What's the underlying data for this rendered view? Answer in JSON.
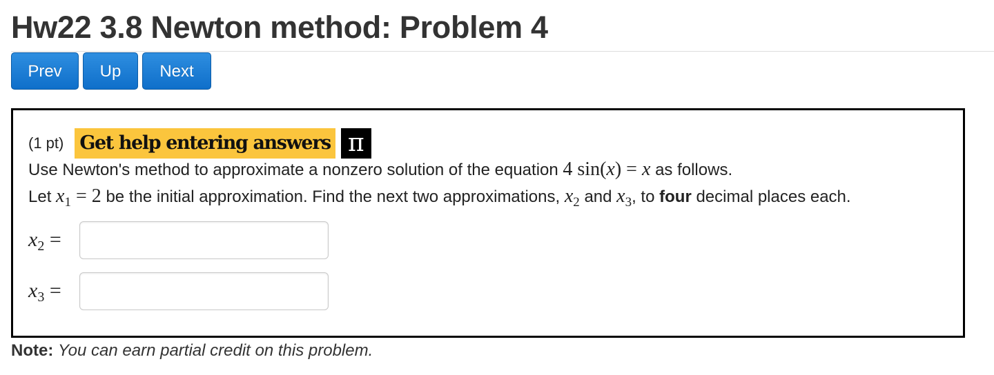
{
  "page": {
    "title": "Hw22 3.8 Newton method: Problem 4"
  },
  "nav": {
    "prev_label": "Prev",
    "up_label": "Up",
    "next_label": "Next",
    "button_color": "#1a7bd4"
  },
  "problem": {
    "points": "(1 pt)",
    "help_link": "Get help entering answers",
    "help_link_color": "#fbc53d",
    "pi_icon": "π",
    "statement_1": {
      "before": "Use Newton's method to approximate a nonzero solution of the equation",
      "equation_coef": "4 sin(",
      "equation_var": "x",
      "equation_close": ") = ",
      "equation_rhs": "x",
      "after": "as follows."
    },
    "statement_2": {
      "let": "Let",
      "x1_var": "x",
      "x1_sub": "1",
      "x1_value": " = 2",
      "middle": "be the initial approximation. Find the next two approximations,",
      "x2_var": "x",
      "x2_sub": "2",
      "and": "and",
      "x3_var": "x",
      "x3_sub": "3",
      "to": ", to",
      "bold_word": "four",
      "end": "decimal places each."
    },
    "answers": [
      {
        "var": "x",
        "sub": "2",
        "eq": "=",
        "value": "",
        "placeholder": ""
      },
      {
        "var": "x",
        "sub": "3",
        "eq": "=",
        "value": "",
        "placeholder": ""
      }
    ]
  },
  "note": {
    "label": "Note:",
    "text": "You can earn partial credit on this problem."
  }
}
